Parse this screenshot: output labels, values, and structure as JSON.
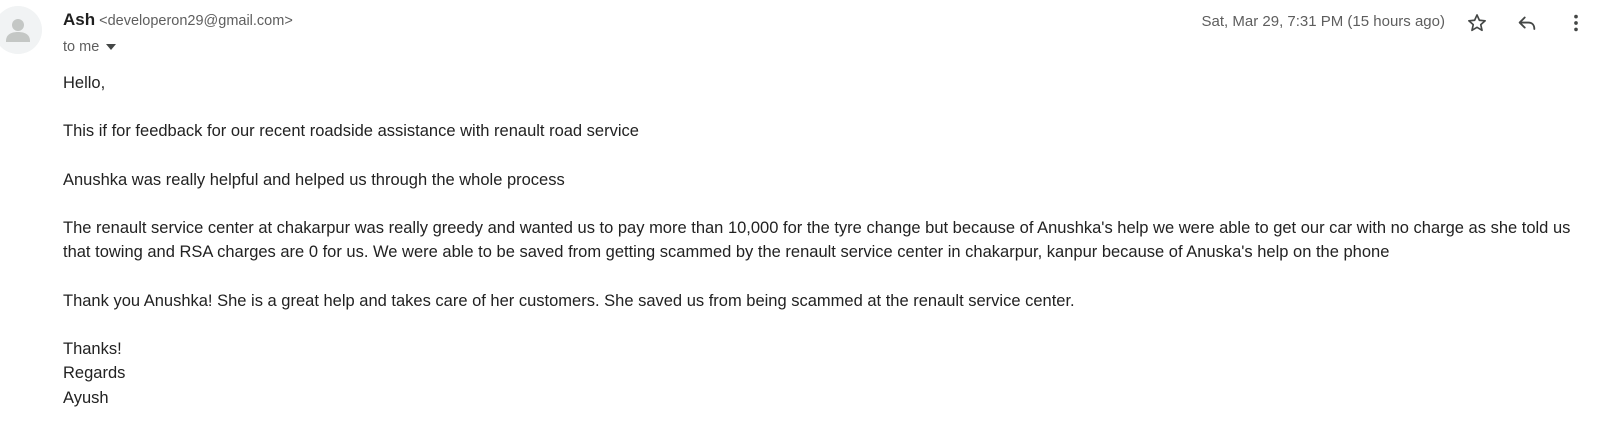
{
  "header": {
    "sender_name": "Ash",
    "sender_email": "<developeron29@gmail.com>",
    "recipient": "to me",
    "date": "Sat, Mar 29, 7:31 PM (15 hours ago)"
  },
  "icons": {
    "avatar": "person-avatar",
    "star": "star-icon",
    "reply": "reply-icon",
    "more": "more-vert-icon",
    "caret": "chevron-down-icon"
  },
  "body": {
    "greeting": "Hello,",
    "paragraphs": [
      "This if for feedback for our recent roadside assistance with renault road service",
      "Anushka was really helpful and helped us through the whole process",
      "The renault service center at chakarpur was really greedy and wanted us to pay more than 10,000 for the tyre change but because of Anushka's help we were able to get our car with no charge as she told us that towing and RSA charges are 0 for us. We were able to be saved from getting scammed by the renault service center in chakarpur, kanpur because of Anuska's help on the phone",
      "Thank you Anushka! She is a great help and takes care of her customers. She saved us from being scammed at the renault service center."
    ],
    "closing": [
      "Thanks!",
      "Regards",
      "Ayush"
    ]
  }
}
